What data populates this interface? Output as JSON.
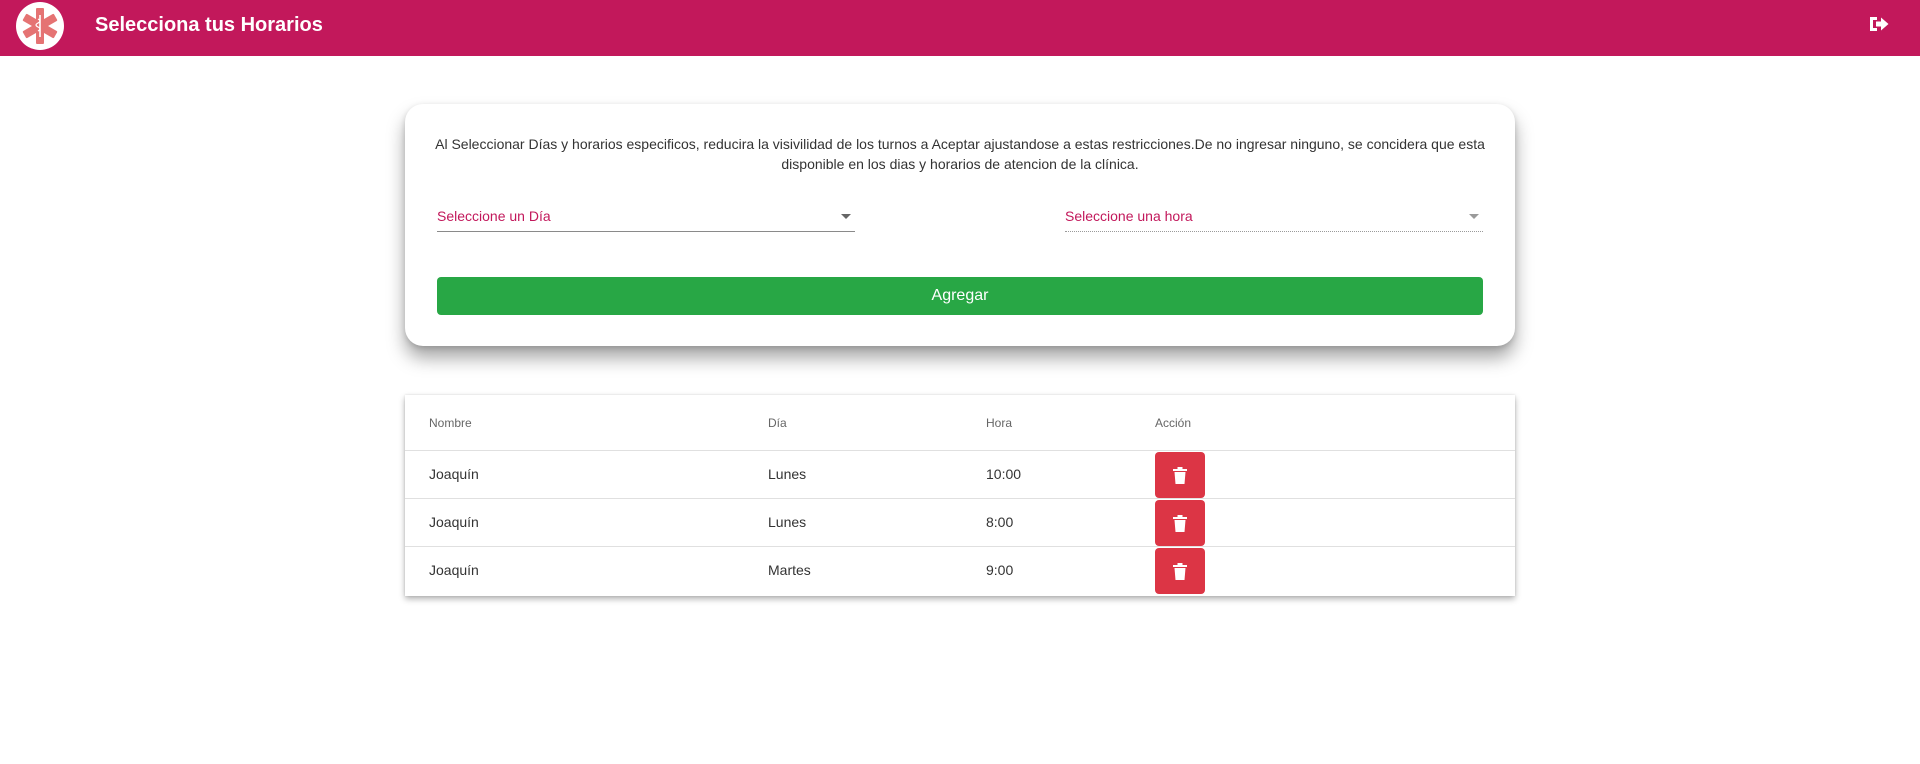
{
  "header": {
    "title": "Selecciona tus Horarios",
    "logo_icon": "medical-star-of-life-icon",
    "logout_icon": "sign-out-icon",
    "bg_color": "#c2185b"
  },
  "form": {
    "info_text": "Al Seleccionar Días y horarios especificos, reducira la visivilidad de los turnos a Aceptar ajustandose a estas restricciones.De no ingresar ninguno, se concidera que esta disponible en los dias y horarios de atencion de la clínica.",
    "day_select_label": "Seleccione un Día",
    "hour_select_label": "Seleccione una hora",
    "add_button_label": "Agregar",
    "add_button_color": "#28a745"
  },
  "table": {
    "columns": [
      "Nombre",
      "Día",
      "Hora",
      "Acción"
    ],
    "rows": [
      {
        "nombre": "Joaquín",
        "dia": "Lunes",
        "hora": "10:00"
      },
      {
        "nombre": "Joaquín",
        "dia": "Lunes",
        "hora": "8:00"
      },
      {
        "nombre": "Joaquín",
        "dia": "Martes",
        "hora": "9:00"
      }
    ],
    "delete_icon": "trash-icon",
    "delete_color": "#dc3545"
  }
}
